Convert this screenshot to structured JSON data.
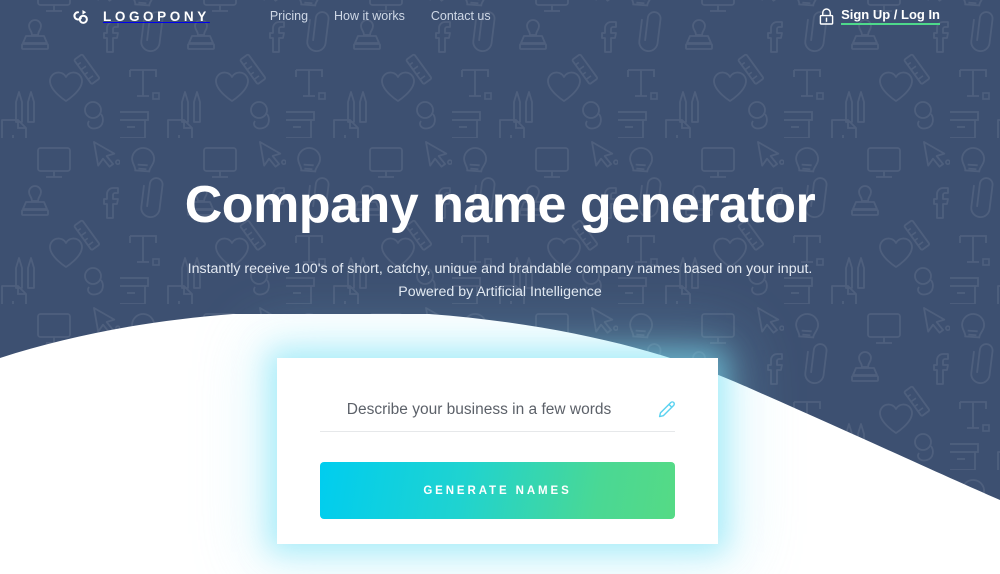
{
  "brand": {
    "name": "LOGOPONY",
    "mark_icon": "infinity-link-logo-icon"
  },
  "nav": {
    "links": [
      {
        "label": "Pricing"
      },
      {
        "label": "How it works"
      },
      {
        "label": "Contact us"
      }
    ]
  },
  "account": {
    "icon": "lock-icon",
    "label": "Sign Up / Log In",
    "underline_color": "#4ed98b"
  },
  "hero": {
    "headline": "Company name generator",
    "subline_1": "Instantly receive 100's of short, catchy, unique and brandable company names based on your input.",
    "subline_2": "Powered by Artificial Intelligence",
    "background_color": "#3d5071",
    "pattern_icons": [
      "lightbulb-icon",
      "cursor-arrow-icon",
      "monitor-icon",
      "facebook-f-icon",
      "paperclip-icon",
      "stamp-icon",
      "ruler-icon",
      "text-tool-t-icon",
      "heart-icon",
      "pen-nib-icon",
      "google-g-icon",
      "archive-box-icon",
      "document-chart-icon"
    ]
  },
  "card": {
    "input": {
      "icon": "pencil-icon",
      "placeholder": "Describe your business in a few words",
      "value": ""
    },
    "button": {
      "label": "GENERATE NAMES",
      "gradient_from": "#00cdef",
      "gradient_to": "#55da85"
    },
    "glow_color": "#78e1f6"
  }
}
